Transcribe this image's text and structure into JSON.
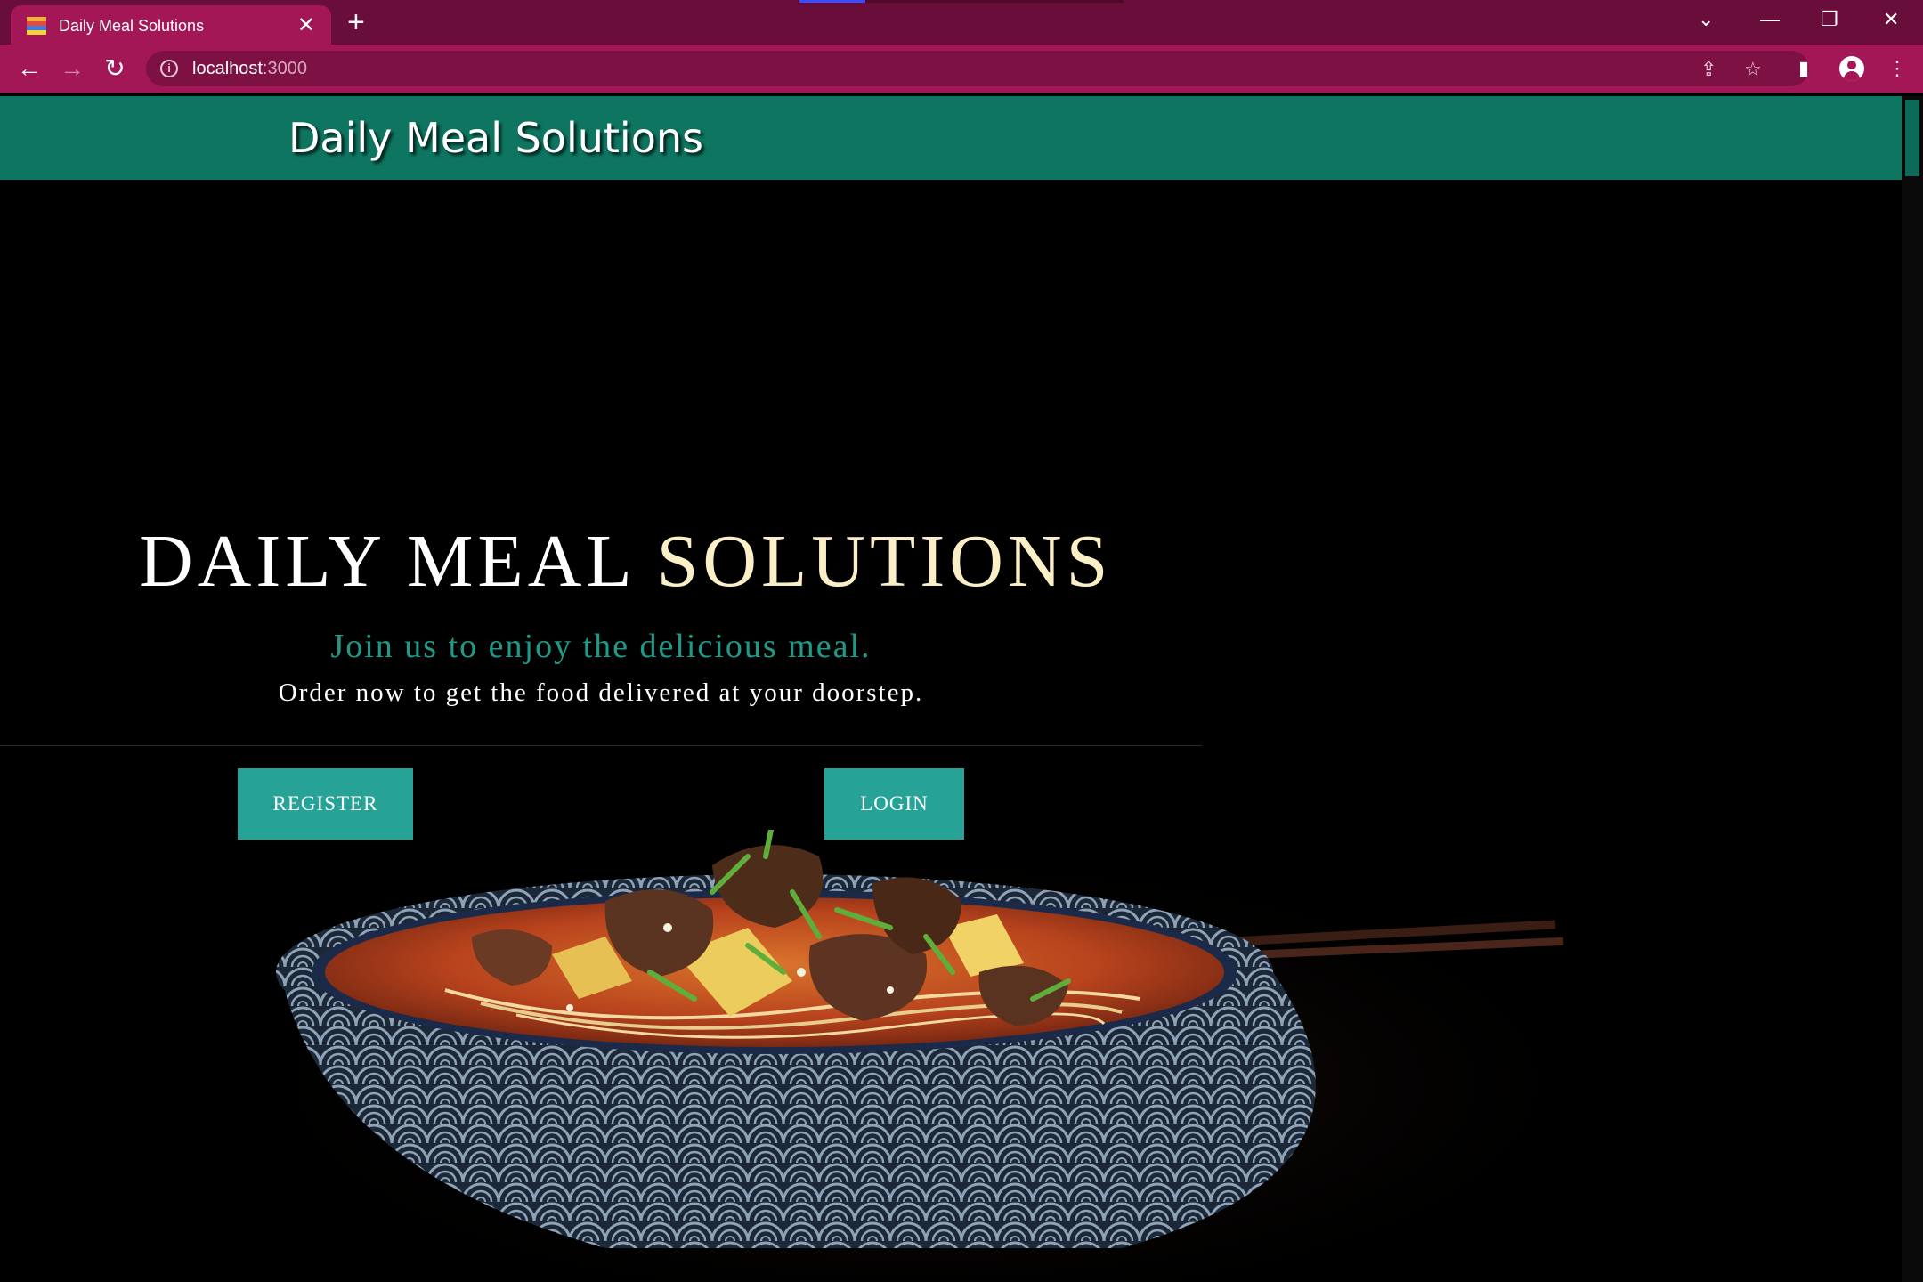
{
  "browser": {
    "tab_title": "Daily Meal Solutions",
    "url_host": "localhost",
    "url_port": ":3000"
  },
  "icons": {
    "tab_close": "close-icon",
    "new_tab": "plus-icon",
    "back": "back-arrow-icon",
    "forward": "forward-arrow-icon",
    "reload": "reload-icon",
    "site_info": "info-icon",
    "share": "share-icon",
    "bookmark": "star-icon",
    "side_panel": "side-panel-icon",
    "profile": "profile-icon",
    "menu": "kebab-menu-icon"
  },
  "page": {
    "header_title": "Daily Meal Solutions",
    "hero": {
      "title_main": "DAILY MEAL ",
      "title_accent": "SOLUTIONS",
      "tagline": "Join us to enjoy the delicious meal.",
      "subline": "Order now to get the food delivered at your doorstep.",
      "register_label": "REGISTER",
      "login_label": "LOGIN"
    }
  },
  "colors": {
    "browser_frame": "#690d3a",
    "browser_toolbar": "#a41756",
    "header_bg": "#0e7561",
    "tagline": "#1f9a88",
    "title_accent": "#fbefc7",
    "button_bg": "#26a297"
  }
}
